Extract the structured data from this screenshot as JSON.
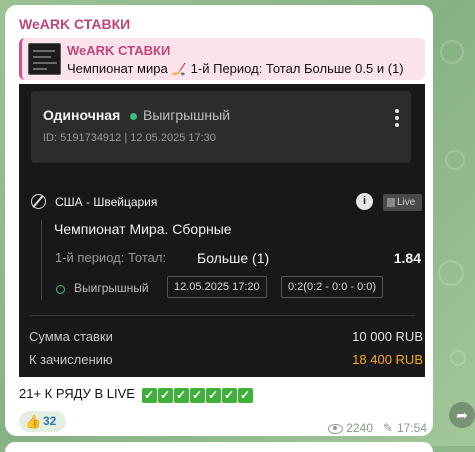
{
  "channel": {
    "name": "WeARK СТАВКИ"
  },
  "reply": {
    "title": "WeARK СТАВКИ",
    "text_part1": "Чемпионат мира",
    "icon": "hockey-stick-icon",
    "text_part2": "1-й Период: Тотал Больше 0.5 и (1)"
  },
  "bet": {
    "type": "Одиночная",
    "status": "Выигрышный",
    "meta": "ID: 5191734912  |  12.05.2025 17:30",
    "match": "США - Швейцария",
    "live_label": "Live",
    "league": "Чемпионат Мира. Сборные",
    "market": "1-й период: Тотал:",
    "selection": "Больше (1)",
    "odds": "1.84",
    "result_status": "Выигрышный",
    "event_time": "12.05.2025 17:20",
    "score": "0:2(0:2 - 0:0 - 0:0)",
    "stake_label": "Сумма ставки",
    "stake_value": "10 000 RUB",
    "payout_label": "К зачислению",
    "payout_value": "18 400 RUB"
  },
  "caption": {
    "text": "21+ К РЯДУ В LIVE",
    "checks": [
      "✓",
      "✓",
      "✓",
      "✓",
      "✓",
      "✓",
      "✓"
    ]
  },
  "reaction": {
    "emoji": "👍",
    "count": "32"
  },
  "meta": {
    "views": "2240",
    "time": "17:54"
  },
  "colors": {
    "accent": "#c0457a",
    "win": "#37c07a",
    "payout": "#f5a623",
    "card": "#181818"
  }
}
